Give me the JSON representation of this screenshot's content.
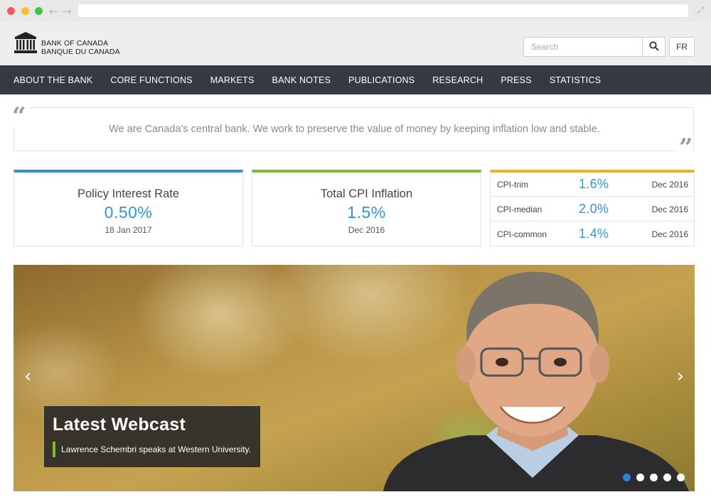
{
  "logo": {
    "name_en": "BANK OF CANADA",
    "name_fr": "BANQUE DU CANADA"
  },
  "header": {
    "search_placeholder": "Search",
    "lang_button": "FR"
  },
  "nav": {
    "items": [
      "ABOUT THE BANK",
      "CORE FUNCTIONS",
      "MARKETS",
      "BANK NOTES",
      "PUBLICATIONS",
      "RESEARCH",
      "PRESS",
      "STATISTICS"
    ]
  },
  "quote": {
    "text": "We are Canada’s central bank. We work to preserve the value of money by keeping inflation low and stable."
  },
  "cards": {
    "policy": {
      "title": "Policy Interest Rate",
      "value": "0.50%",
      "date": "18 Jan 2017",
      "accent": "#3e8cd0"
    },
    "cpi": {
      "title": "Total CPI Inflation",
      "value": "1.5%",
      "date": "Dec 2016",
      "accent": "#7dbb2b"
    },
    "core": {
      "accent": "#f0b022",
      "rows": [
        {
          "name": "CPI-trim",
          "value": "1.6%",
          "date": "Dec 2016"
        },
        {
          "name": "CPI-median",
          "value": "2.0%",
          "date": "Dec 2016"
        },
        {
          "name": "CPI-common",
          "value": "1.4%",
          "date": "Dec 2016"
        }
      ]
    }
  },
  "hero": {
    "title": "Latest Webcast",
    "subtitle": "Lawrence Schembri speaks at Western University.",
    "slide_count": 5,
    "active_slide": 1,
    "accent": "#7dbb2b",
    "dot_active_color": "#2f7fd6"
  },
  "icons": {
    "back": "back-arrow-icon",
    "forward": "forward-arrow-icon",
    "expand": "expand-icon",
    "search": "search-icon",
    "prev": "chevron-left-icon",
    "next": "chevron-right-icon"
  }
}
